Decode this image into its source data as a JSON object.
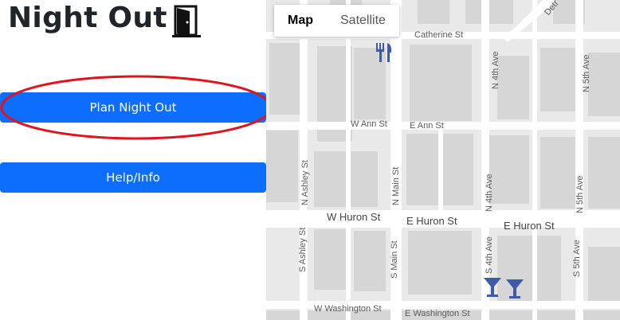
{
  "app": {
    "title": "Night Out"
  },
  "buttons": {
    "plan": "Plan Night Out",
    "help": "Help/Info"
  },
  "map": {
    "type_control": {
      "map": "Map",
      "satellite": "Satellite",
      "selected": "Map"
    },
    "streets": {
      "catherine": "Catherine St",
      "w_ann": "W Ann St",
      "e_ann": "E Ann St",
      "w_huron": "W Huron St",
      "e_huron_1": "E Huron St",
      "e_huron_2": "E Huron St",
      "w_washington": "W Washington St",
      "e_washington": "E Washington St",
      "n_main": "N Main St",
      "s_main": "S Main St",
      "n_ashley": "N Ashley St",
      "s_ashley": "S Ashley St",
      "n_4th_1": "N 4th Ave",
      "n_4th_2": "N 4th Ave",
      "s_4th": "S 4th Ave",
      "n_5th_1": "N 5th Ave",
      "n_5th_2": "N 5th Ave",
      "s_5th": "S 5th Ave",
      "detroit": "Detr"
    },
    "markers": [
      "restaurant-icon",
      "bar-icon",
      "bar-icon"
    ],
    "colors": {
      "marker": "#3f5aa6",
      "building": "#d9d9d9",
      "road": "#ffffff",
      "button": "#0d6efd",
      "highlight": "#e0141e"
    }
  }
}
